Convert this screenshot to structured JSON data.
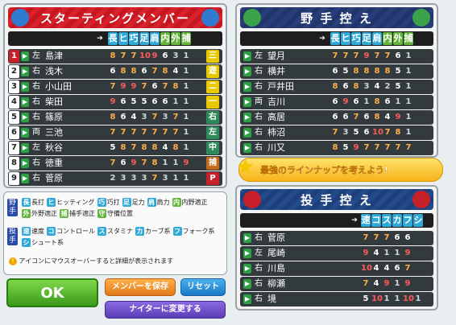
{
  "starting": {
    "title": "スターティングメンバー",
    "stat_heads": [
      "長",
      "ヒ",
      "巧",
      "足",
      "肩",
      "内",
      "外",
      "捕"
    ],
    "rows": [
      {
        "num": "1",
        "hand": "左",
        "name": "島津",
        "stats": [
          "8",
          "7",
          "7",
          "10",
          "9",
          "6",
          "3",
          "1"
        ],
        "pos": "三",
        "poscolor": "#e8c800"
      },
      {
        "num": "2",
        "hand": "右",
        "name": "浅木",
        "stats": [
          "6",
          "8",
          "8",
          "6",
          "7",
          "8",
          "4",
          "1"
        ],
        "pos": "遊",
        "poscolor": "#e8c800"
      },
      {
        "num": "3",
        "hand": "右",
        "name": "小山田",
        "stats": [
          "7",
          "9",
          "9",
          "7",
          "6",
          "7",
          "8",
          "1"
        ],
        "pos": "二",
        "poscolor": "#e8c800"
      },
      {
        "num": "4",
        "hand": "右",
        "name": "柴田",
        "stats": [
          "9",
          "6",
          "5",
          "5",
          "6",
          "6",
          "1",
          "1"
        ],
        "pos": "一",
        "poscolor": "#e8c800"
      },
      {
        "num": "5",
        "hand": "右",
        "name": "篠原",
        "stats": [
          "8",
          "6",
          "4",
          "3",
          "7",
          "3",
          "7",
          "1"
        ],
        "pos": "右",
        "poscolor": "#2e8a5a"
      },
      {
        "num": "6",
        "hand": "両",
        "name": "三池",
        "stats": [
          "7",
          "7",
          "7",
          "7",
          "7",
          "7",
          "7",
          "1"
        ],
        "pos": "左",
        "poscolor": "#2e8a5a"
      },
      {
        "num": "7",
        "hand": "左",
        "name": "秋谷",
        "stats": [
          "5",
          "8",
          "7",
          "8",
          "8",
          "4",
          "8",
          "1"
        ],
        "pos": "中",
        "poscolor": "#2e8a5a"
      },
      {
        "num": "8",
        "hand": "右",
        "name": "徳重",
        "stats": [
          "7",
          "6",
          "9",
          "7",
          "8",
          "1",
          "1",
          "9"
        ],
        "pos": "捕",
        "poscolor": "#c26a1a"
      },
      {
        "num": "9",
        "hand": "右",
        "name": "菅原",
        "stats": [
          "2",
          "3",
          "3",
          "3",
          "7",
          "3",
          "1",
          "1"
        ],
        "pos": "P",
        "poscolor": "#c7202a"
      }
    ]
  },
  "bench": {
    "title": "野 手 控 え",
    "stat_heads": [
      "長",
      "ヒ",
      "巧",
      "足",
      "肩",
      "内",
      "外",
      "捕"
    ],
    "rows": [
      {
        "hand": "左",
        "name": "望月",
        "stats": [
          "7",
          "7",
          "7",
          "9",
          "7",
          "7",
          "6",
          "1"
        ]
      },
      {
        "hand": "右",
        "name": "横井",
        "stats": [
          "6",
          "5",
          "8",
          "8",
          "8",
          "8",
          "5",
          "1"
        ]
      },
      {
        "hand": "右",
        "name": "戸井田",
        "stats": [
          "8",
          "6",
          "8",
          "3",
          "4",
          "2",
          "5",
          "1"
        ]
      },
      {
        "hand": "両",
        "name": "吉川",
        "stats": [
          "6",
          "9",
          "6",
          "1",
          "8",
          "6",
          "1",
          "1"
        ]
      },
      {
        "hand": "右",
        "name": "高居",
        "stats": [
          "6",
          "6",
          "7",
          "6",
          "8",
          "4",
          "9",
          "1"
        ]
      },
      {
        "hand": "右",
        "name": "柿沼",
        "stats": [
          "7",
          "3",
          "5",
          "6",
          "10",
          "7",
          "8",
          "1"
        ]
      },
      {
        "hand": "右",
        "name": "川又",
        "stats": [
          "8",
          "5",
          "9",
          "7",
          "7",
          "7",
          "7",
          "7"
        ]
      }
    ]
  },
  "banner": "最強のラインナップを考えよう!",
  "pitchers": {
    "title": "投 手 控 え",
    "stat_heads": [
      "速",
      "コ",
      "ス",
      "カ",
      "フ",
      "シ"
    ],
    "rows": [
      {
        "hand": "右",
        "name": "菅原",
        "stats": [
          "7",
          "7",
          "7",
          "6",
          "6",
          ""
        ]
      },
      {
        "hand": "左",
        "name": "尾崎",
        "stats": [
          "9",
          "4",
          "1",
          "1",
          "9",
          ""
        ]
      },
      {
        "hand": "右",
        "name": "川島",
        "stats": [
          "10",
          "4",
          "4",
          "6",
          "7",
          ""
        ]
      },
      {
        "hand": "右",
        "name": "柳瀬",
        "stats": [
          "7",
          "4",
          "9",
          "1",
          "9",
          ""
        ]
      },
      {
        "hand": "右",
        "name": "境",
        "stats": [
          "5",
          "10",
          "1",
          "1",
          "10",
          "1"
        ]
      }
    ]
  },
  "legend": {
    "fielder_label": "野手",
    "pitcher_label": "投手",
    "fielder_items": [
      {
        "k": "長",
        "t": "長打",
        "c": "#2fa9d8"
      },
      {
        "k": "ヒ",
        "t": "ヒッティング",
        "c": "#2fa9d8"
      },
      {
        "k": "巧",
        "t": "巧打",
        "c": "#2fa9d8"
      },
      {
        "k": "足",
        "t": "足力",
        "c": "#2fa9d8"
      },
      {
        "k": "肩",
        "t": "肩力",
        "c": "#2fa9d8"
      },
      {
        "k": "内",
        "t": "内野適正",
        "c": "#62b53a"
      },
      {
        "k": "外",
        "t": "外野適正",
        "c": "#62b53a"
      },
      {
        "k": "捕",
        "t": "捕手適正",
        "c": "#62b53a"
      },
      {
        "k": "守",
        "t": "守備位置",
        "c": "#62b53a"
      }
    ],
    "pitcher_items": [
      {
        "k": "速",
        "t": "速度",
        "c": "#2fa9d8"
      },
      {
        "k": "コ",
        "t": "コントロール",
        "c": "#2fa9d8"
      },
      {
        "k": "ス",
        "t": "スタミナ",
        "c": "#2fa9d8"
      },
      {
        "k": "カ",
        "t": "カーブ系",
        "c": "#2fa9d8"
      },
      {
        "k": "フ",
        "t": "フォーク系",
        "c": "#2fa9d8"
      },
      {
        "k": "シ",
        "t": "シュート系",
        "c": "#2fa9d8"
      }
    ]
  },
  "hint": "アイコンにマウスオーバーすると詳細が表示されます",
  "buttons": {
    "ok": "OK",
    "save": "メンバーを保存",
    "reset": "リセット",
    "night": "ナイターに変更する"
  }
}
